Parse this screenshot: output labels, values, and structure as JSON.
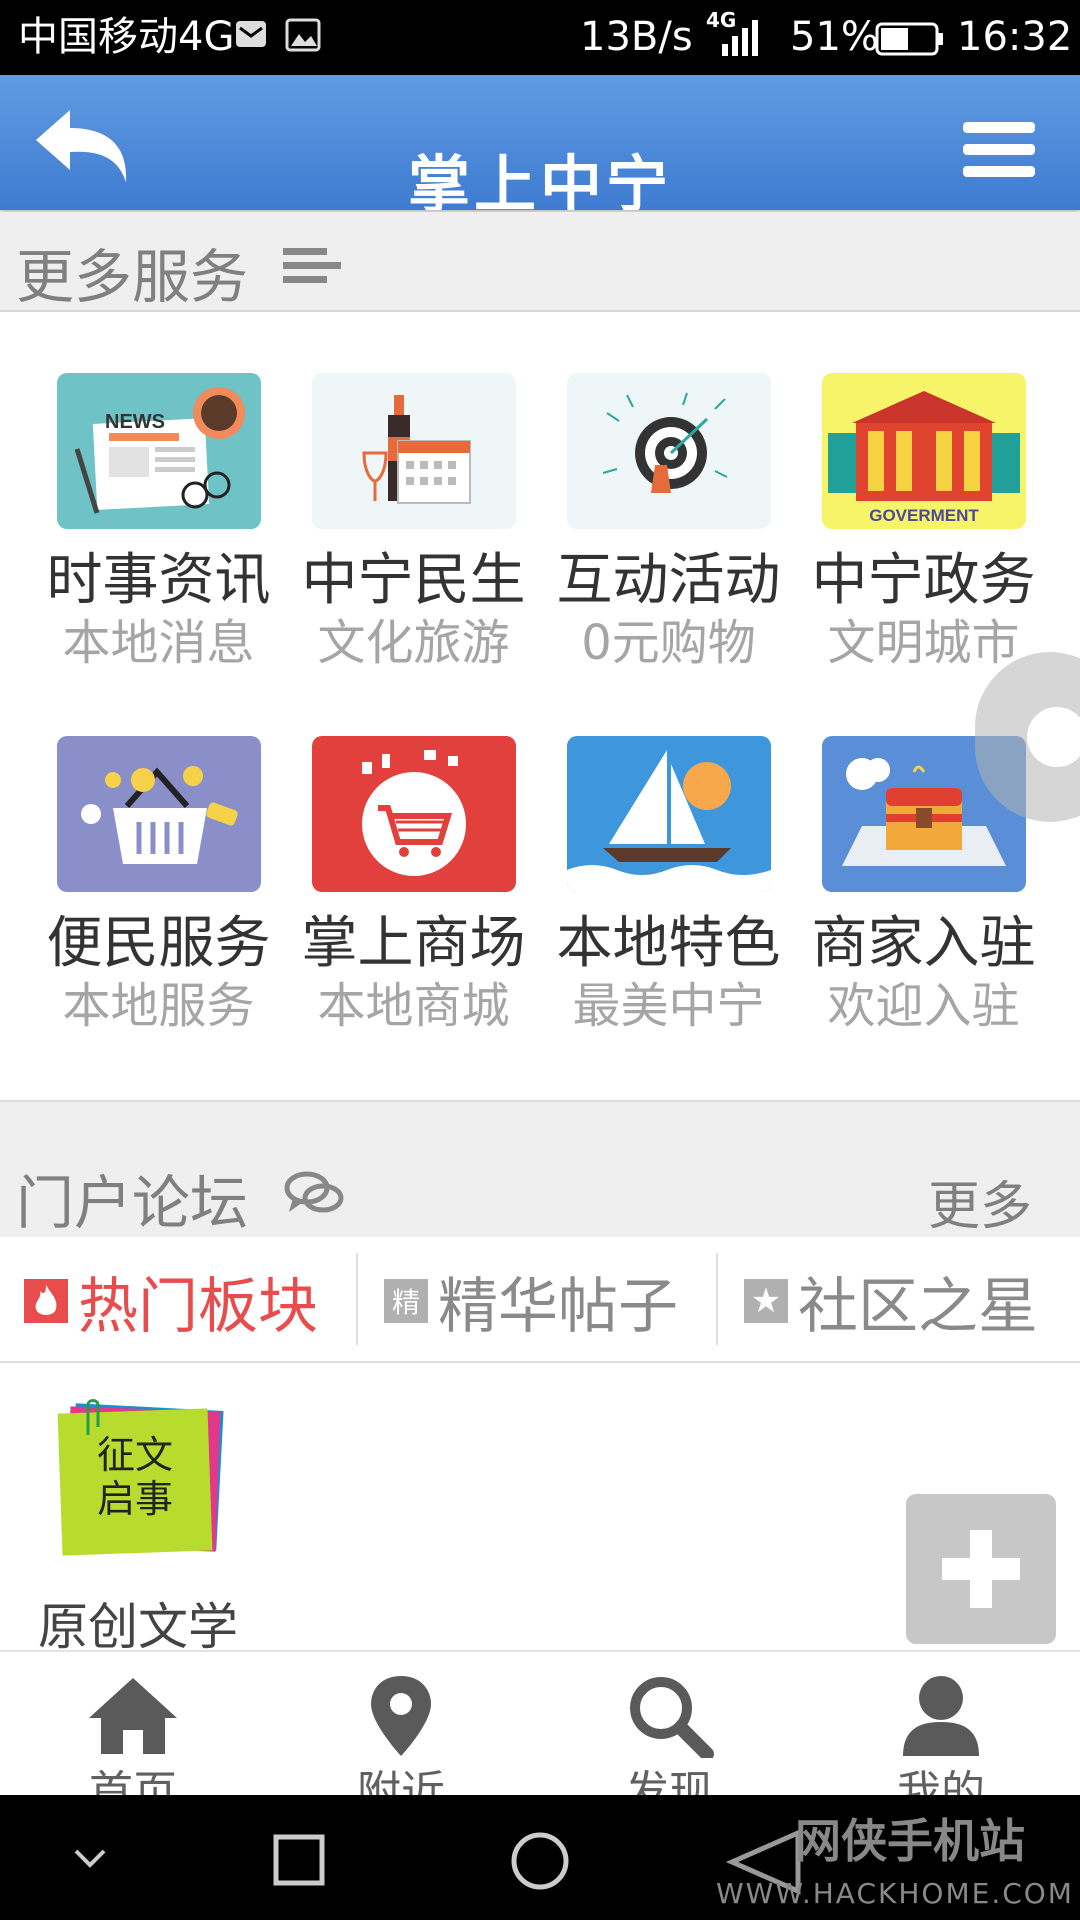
{
  "status_bar": {
    "carrier": "中国移动4G",
    "speed": "13B/s",
    "network": "4G",
    "battery": "51%",
    "time": "16:32"
  },
  "header": {
    "title": "掌上中宁",
    "back_icon": "back-arrow-icon",
    "menu_icon": "hamburger-menu-icon",
    "color_top": "#5f9be2",
    "color_bottom": "#3f7bd0"
  },
  "services": {
    "title": "更多服务",
    "items": [
      {
        "title": "时事资讯",
        "sub": "本地消息",
        "icon": "news-icon"
      },
      {
        "title": "中宁民生",
        "sub": "文化旅游",
        "icon": "wine-calendar-icon"
      },
      {
        "title": "互动活动",
        "sub": "0元购物",
        "icon": "target-icon"
      },
      {
        "title": "中宁政务",
        "sub": "文明城市",
        "icon": "government-building-icon",
        "badge": "GOVERMENT"
      },
      {
        "title": "便民服务",
        "sub": "本地服务",
        "icon": "shopping-basket-icon"
      },
      {
        "title": "掌上商场",
        "sub": "本地商城",
        "icon": "shopping-cart-icon"
      },
      {
        "title": "本地特色",
        "sub": "最美中宁",
        "icon": "sailboat-icon"
      },
      {
        "title": "商家入驻",
        "sub": "欢迎入驻",
        "icon": "treasure-chest-icon"
      }
    ]
  },
  "forum": {
    "title": "门户论坛",
    "more": "更多",
    "tabs": [
      {
        "label": "热门板块",
        "icon_text": "",
        "active": true
      },
      {
        "label": "精华帖子",
        "icon_text": "精",
        "active": false
      },
      {
        "label": "社区之星",
        "icon_text": "★",
        "active": false
      }
    ],
    "post": {
      "note_text_line1": "征文",
      "note_text_line2": "启事",
      "title": "原创文学"
    },
    "add_icon": "plus-icon",
    "accent_red": "#e84c4c"
  },
  "bottom_nav": [
    {
      "label": "首页",
      "icon": "home-icon"
    },
    {
      "label": "附近",
      "icon": "location-pin-icon"
    },
    {
      "label": "发现",
      "icon": "search-icon"
    },
    {
      "label": "我的",
      "icon": "user-icon"
    }
  ],
  "watermark": {
    "text": "网侠手机站",
    "url": "WWW.HACKHOME.COM"
  }
}
